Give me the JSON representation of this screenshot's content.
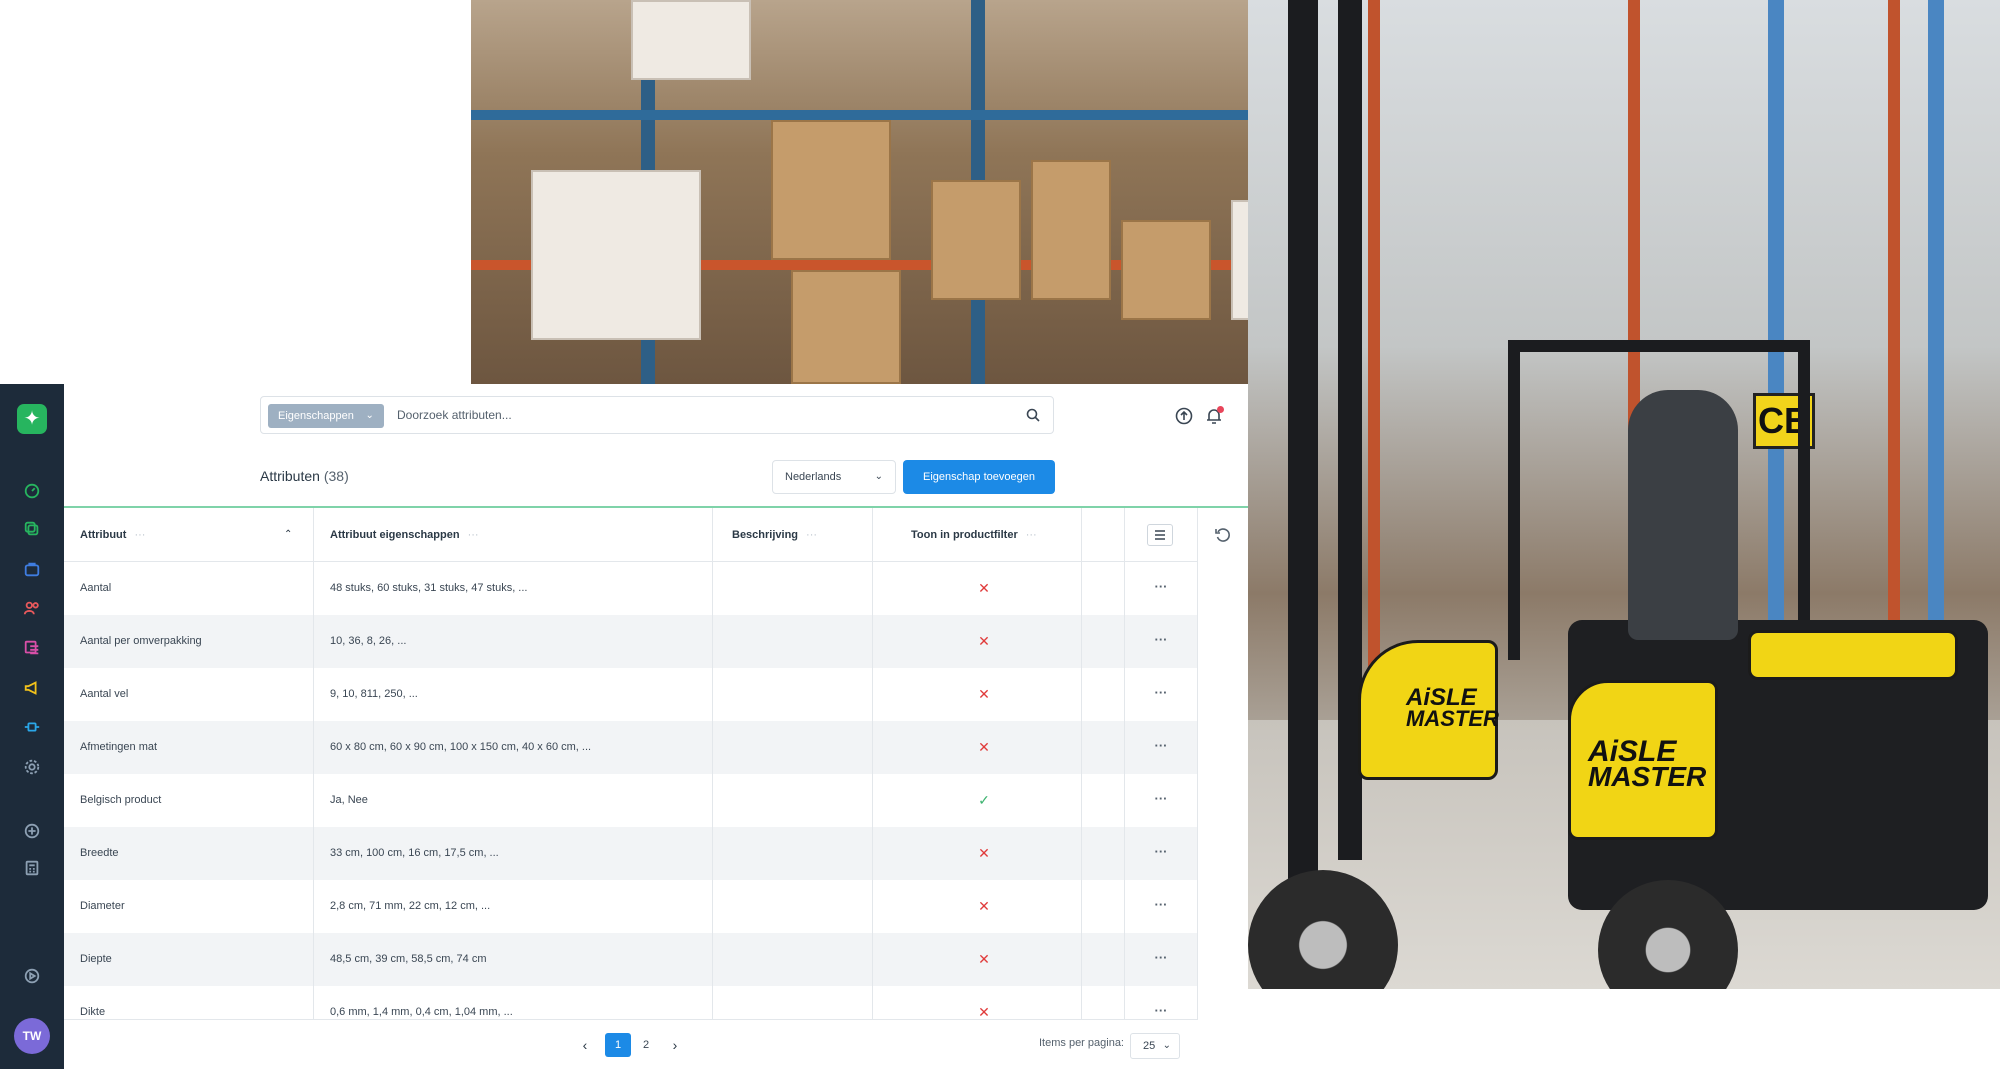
{
  "search": {
    "chip_label": "Eigenschappen",
    "placeholder": "Doorzoek attributen..."
  },
  "header": {
    "title": "Attributen",
    "count": "(38)",
    "language": "Nederlands",
    "add_button": "Eigenschap toevoegen"
  },
  "user": {
    "initials": "TW"
  },
  "table": {
    "columns": {
      "attribuut": "Attribuut",
      "eigenschappen": "Attribuut eigenschappen",
      "beschrijving": "Beschrijving",
      "filter": "Toon in productfilter",
      "dots": "···"
    },
    "rows": [
      {
        "name": "Aantal",
        "values": "48 stuks, 60 stuks, 31 stuks, 47 stuks, ...",
        "description": "",
        "in_filter": false
      },
      {
        "name": "Aantal per omverpakking",
        "values": "10, 36, 8, 26, ...",
        "description": "",
        "in_filter": false
      },
      {
        "name": "Aantal vel",
        "values": "9, 10, 811, 250, ...",
        "description": "",
        "in_filter": false
      },
      {
        "name": "Afmetingen mat",
        "values": "60 x 80 cm, 60 x 90 cm, 100 x 150 cm, 40 x 60 cm, ...",
        "description": "",
        "in_filter": false
      },
      {
        "name": "Belgisch product",
        "values": "Ja, Nee",
        "description": "",
        "in_filter": true
      },
      {
        "name": "Breedte",
        "values": "33 cm, 100 cm, 16 cm, 17,5 cm, ...",
        "description": "",
        "in_filter": false
      },
      {
        "name": "Diameter",
        "values": "2,8 cm, 71 mm, 22 cm, 12 cm, ...",
        "description": "",
        "in_filter": false
      },
      {
        "name": "Diepte",
        "values": "48,5 cm, 39 cm, 58,5 cm, 74 cm",
        "description": "",
        "in_filter": false
      },
      {
        "name": "Dikte",
        "values": "0,6 mm, 1,4 mm, 0,4 cm, 1,04 mm, ...",
        "description": "",
        "in_filter": false
      }
    ],
    "row_action": "···",
    "no_mark": "✕",
    "yes_mark": "✓"
  },
  "pagination": {
    "pages": [
      "1",
      "2"
    ],
    "current": "1",
    "prev": "‹",
    "next": "›",
    "items_per_page_label": "Items per pagina:",
    "items_per_page": "25"
  },
  "photo": {
    "forklift_brand_line1": "AiSLE",
    "forklift_brand_line2": "MASTER",
    "rack_sign": "CB"
  },
  "colors": {
    "sidebar_bg": "#1d2b3a",
    "primary": "#1c8ae6",
    "accent_green": "#27b55f",
    "no_mark": "#e03b3b",
    "yes_mark": "#3db36f"
  },
  "icons": {
    "sidebar": [
      "dashboard-icon",
      "copy-icon",
      "shopping-bag-icon",
      "users-icon",
      "list-icon",
      "megaphone-icon",
      "plug-icon",
      "settings-icon",
      "plus-circle-icon",
      "calculator-icon",
      "play-circle-icon"
    ]
  }
}
